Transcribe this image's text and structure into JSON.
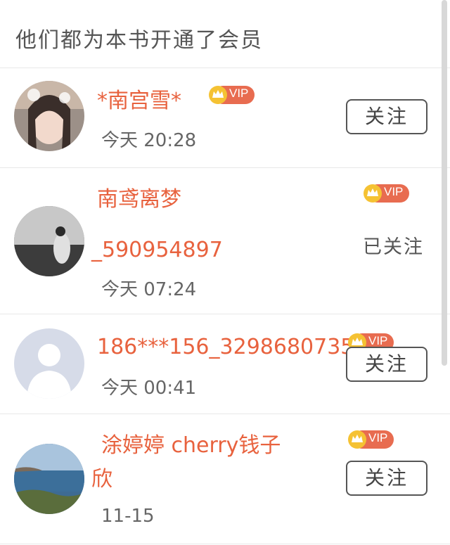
{
  "header": {
    "title": "他们都为本书开通了会员"
  },
  "members": [
    {
      "name": "*南宫雪*",
      "time": "今天 20:28",
      "vip": "VIP",
      "follow": "关注"
    },
    {
      "name_line1": "南鸢离梦",
      "name_line2": "_590954897",
      "time": "今天 07:24",
      "vip": "VIP",
      "follow": "已关注"
    },
    {
      "name": "186***156_3298680735",
      "time": "今天 00:41",
      "vip": "VIP",
      "follow": "关注"
    },
    {
      "name_line1": "涂婷婷 cherry钱子",
      "name_line2": "欣",
      "time": "11-15",
      "vip": "VIP",
      "follow": "关注"
    }
  ],
  "colors": {
    "name": "#e8623e",
    "vip_badge": "#e86c50",
    "crown": "#f5c233"
  },
  "icons": [
    "avatar",
    "crown-icon"
  ]
}
